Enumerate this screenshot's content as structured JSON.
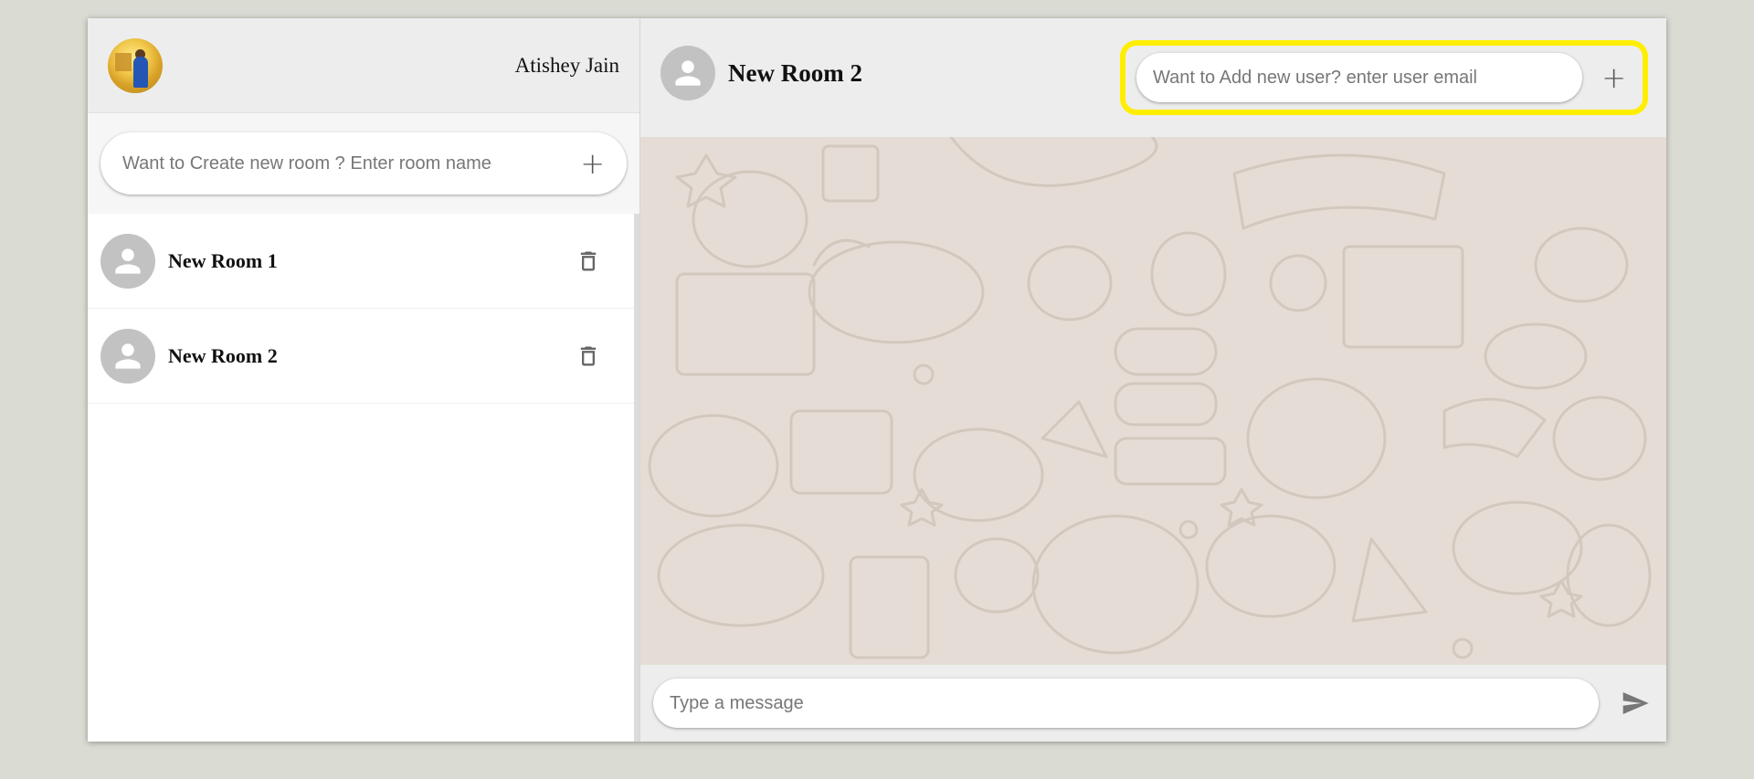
{
  "user": {
    "name": "Atishey Jain"
  },
  "sidebar": {
    "new_room_placeholder": "Want to Create new room ? Enter room name",
    "plus_glyph": "+",
    "rooms": [
      {
        "name": "New Room 1"
      },
      {
        "name": "New Room 2"
      }
    ]
  },
  "chat": {
    "title": "New Room 2",
    "add_user_placeholder": "Want to Add new user? enter user email",
    "plus_glyph": "+",
    "message_placeholder": "Type a message"
  },
  "colors": {
    "highlight": "#ffee00",
    "background": "#dadbd3",
    "chat_wallpaper": "#e5ddd5",
    "avatar_grey": "#c2c2c2"
  }
}
